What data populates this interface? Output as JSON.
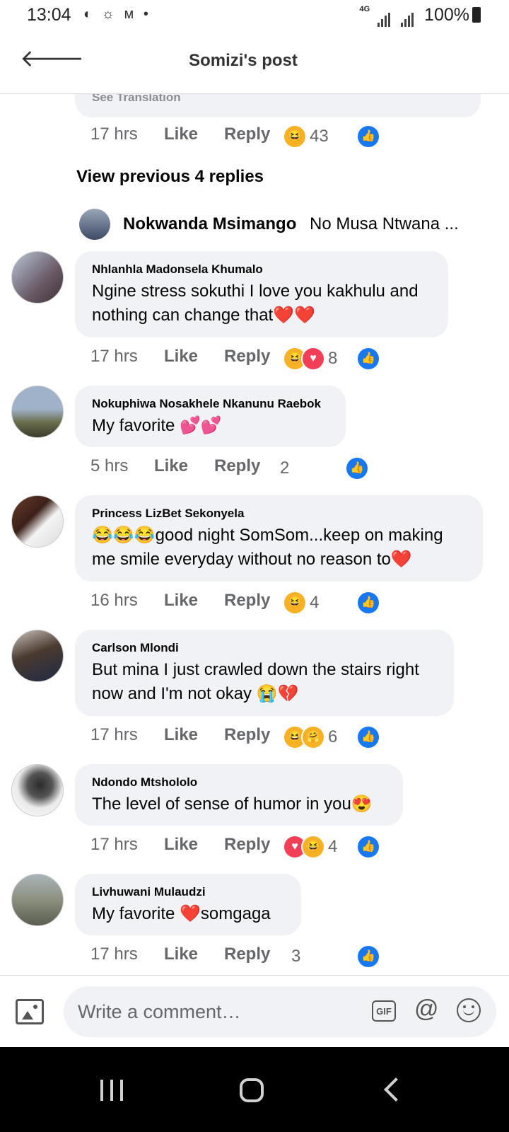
{
  "status_bar": {
    "time": "13:04",
    "network": "4G",
    "battery": "100%"
  },
  "header": {
    "title": "Somizi's post"
  },
  "previous_comment": {
    "translation_label": "See Translation",
    "time": "17 hrs",
    "like": "Like",
    "reply": "Reply",
    "reactions": [
      "haha",
      "like"
    ],
    "count": "43"
  },
  "view_previous": "View previous 4 replies",
  "collapsed_reply": {
    "author": "Nokwanda Msimango",
    "text": "No Musa Ntwana ..."
  },
  "comments": [
    {
      "author": "Nhlanhla Madonsela Khumalo",
      "text": "Ngine stress sokuthi I love you kakhulu and nothing can change that❤️❤️",
      "time": "17 hrs",
      "like": "Like",
      "reply": "Reply",
      "reactions": [
        "like",
        "haha",
        "love"
      ],
      "count": "8"
    },
    {
      "author": "Nokuphiwa Nosakhele Nkanunu Raebok",
      "text": "My favorite 💕💕",
      "time": "5 hrs",
      "like": "Like",
      "reply": "Reply",
      "reactions": [
        "like"
      ],
      "count": "2"
    },
    {
      "author": "Princess LizBet Sekonyela",
      "text": "😂😂😂good night SomSom...keep on making me smile everyday without no reason to❤️",
      "time": "16 hrs",
      "like": "Like",
      "reply": "Reply",
      "reactions": [
        "like",
        "haha"
      ],
      "count": "4"
    },
    {
      "author": "Carlson Mlondi",
      "text": "But mina I just crawled down the stairs right now and I'm not okay 😭💔",
      "time": "17 hrs",
      "like": "Like",
      "reply": "Reply",
      "reactions": [
        "haha",
        "care",
        "like"
      ],
      "count": "6"
    },
    {
      "author": "Ndondo Mtshololo",
      "text": "The level of sense of humor in you😍",
      "time": "17 hrs",
      "like": "Like",
      "reply": "Reply",
      "reactions": [
        "like",
        "love",
        "haha"
      ],
      "count": "4"
    },
    {
      "author": "Livhuwani Mulaudzi",
      "text": "My favorite ❤️somgaga",
      "time": "17 hrs",
      "like": "Like",
      "reply": "Reply",
      "reactions": [
        "like"
      ],
      "count": "3"
    }
  ],
  "composer": {
    "placeholder": "Write a comment…",
    "gif_label": "GIF",
    "mention_label": "@"
  },
  "reaction_icons": {
    "like": "👍",
    "love": "♥",
    "haha": "😆",
    "care": "🤗"
  }
}
